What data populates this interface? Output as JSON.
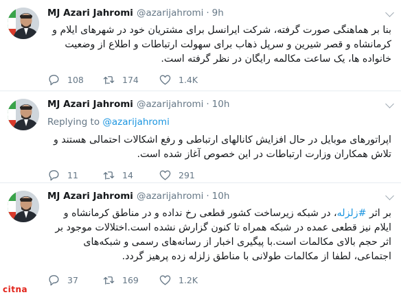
{
  "tweets": [
    {
      "name": "MJ Azari Jahromi",
      "handle": "@azarijahromi",
      "time": "9h",
      "replying_label": "",
      "replying_to": "",
      "text": "بنا بر هماهنگی صورت گرفته، شرکت ایرانسل برای مشتریان خود در شهرهای ایلام و کرمانشاه و قصر شیرین و سرپل ذهاب برای سهولت ارتباطات و اطلاع از وضعیت خانواده ها، یک ساعت مکالمه رایگان در نظر گرفته است.",
      "replies": "108",
      "retweets": "174",
      "likes": "1.4K"
    },
    {
      "name": "MJ Azari Jahromi",
      "handle": "@azarijahromi",
      "time": "10h",
      "replying_label": "Replying to",
      "replying_to": "@azarijahromi",
      "text": "اپراتورهای موبایل در حال افزایش کانالهای ارتباطی و رفع اشکالات احتمالی هستند و تلاش همکاران وزارت ارتباطات در این خصوص آغاز شده است.",
      "replies": "11",
      "retweets": "14",
      "likes": "291"
    },
    {
      "name": "MJ Azari Jahromi",
      "handle": "@azarijahromi",
      "time": "10h",
      "replying_label": "",
      "replying_to": "",
      "text_prefix": "بر اثر ",
      "hashtag": "#زلزله",
      "text": "، در شبکه زیرساخت کشور قطعی رخ نداده و در مناطق کرمانشاه و ایلام نیز قطعی عمده در شبکه همراه تا کنون گزارش نشده است.اختلالات موجود بر اثر حجم بالای مکالمات است.با پیگیری اخبار از رسانه‌های رسمی و شبکه‌های اجتماعی، لطفا از مکالمات طولانی با مناطق زلزله زده پرهیز گردد.",
      "replies": "37",
      "retweets": "169",
      "likes": "1.2K"
    }
  ],
  "watermark": "citna",
  "icons": {
    "reply": "reply-icon",
    "retweet": "retweet-icon",
    "like": "heart-icon",
    "menu": "chevron-down-icon"
  },
  "colors": {
    "text": "#14171a",
    "muted": "#657786",
    "link": "#1b95e0",
    "watermark": "#e2231a"
  }
}
